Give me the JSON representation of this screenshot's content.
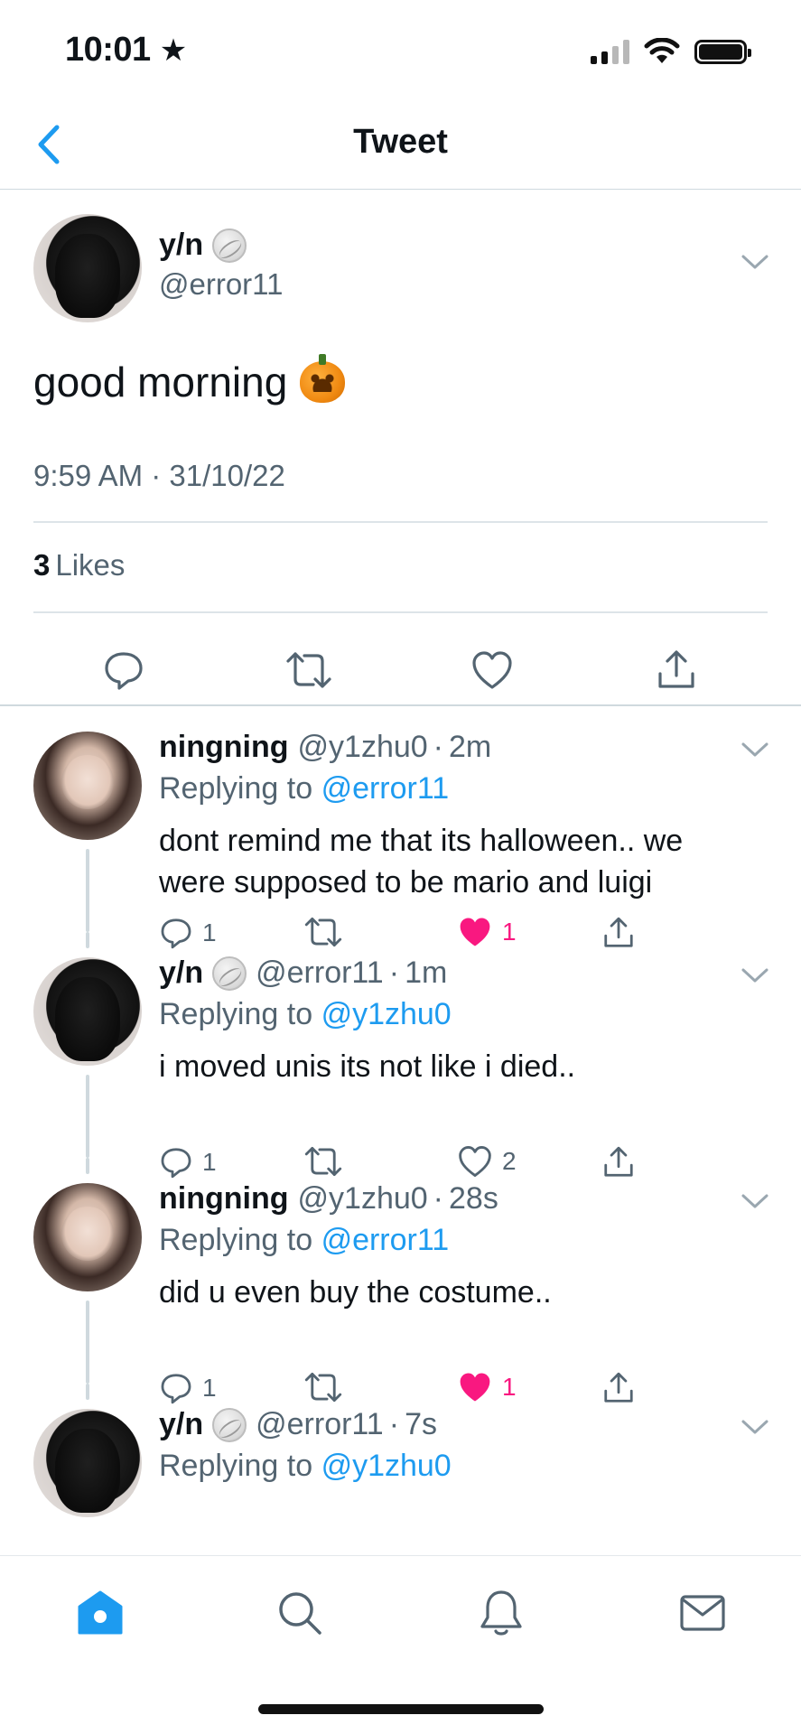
{
  "status_bar": {
    "time": "10:01",
    "location_icon": "star-icon",
    "icons": [
      "signal-icon",
      "wifi-icon",
      "battery-icon"
    ]
  },
  "nav": {
    "title": "Tweet",
    "back_icon": "chevron-left-icon"
  },
  "main_tweet": {
    "name": "y/n",
    "name_emoji": "volleyball-emoji",
    "handle": "@error11",
    "text": "good morning",
    "text_emoji": "jack-o-lantern-emoji",
    "timestamp": "9:59 AM · 31/10/22",
    "likes_count": "3",
    "likes_label": "Likes",
    "actions": [
      "reply-icon",
      "retweet-icon",
      "like-icon",
      "share-icon"
    ]
  },
  "replies": [
    {
      "name": "ningning",
      "handle": "@y1zhu0",
      "dot": "·",
      "time": "2m",
      "replying_label": "Replying to",
      "replying_to": "@error11",
      "text": "dont remind me that its halloween.. we were supposed to be mario and luigi",
      "reply_count": "1",
      "like_count": "1",
      "liked": true
    },
    {
      "name": "y/n",
      "handle": "@error11",
      "dot": "·",
      "time": "1m",
      "replying_label": "Replying to",
      "replying_to": "@y1zhu0",
      "text": "i moved unis its not like i died..",
      "reply_count": "1",
      "like_count": "2",
      "liked": false
    },
    {
      "name": "ningning",
      "handle": "@y1zhu0",
      "dot": "·",
      "time": "28s",
      "replying_label": "Replying to",
      "replying_to": "@error11",
      "text": "did u even buy the costume..",
      "reply_count": "1",
      "like_count": "1",
      "liked": true
    },
    {
      "name": "y/n",
      "handle": "@error11",
      "dot": "·",
      "time": "7s",
      "replying_label": "Replying to",
      "replying_to": "@y1zhu0"
    }
  ],
  "tab_bar": {
    "tabs": [
      "home-icon",
      "search-icon",
      "notifications-icon",
      "messages-icon"
    ],
    "active": "home-icon"
  },
  "colors": {
    "accent": "#1d9bf0",
    "like": "#f91880",
    "secondary_text": "#536471",
    "primary_text": "#0f1419",
    "divider": "#cfd9de"
  }
}
